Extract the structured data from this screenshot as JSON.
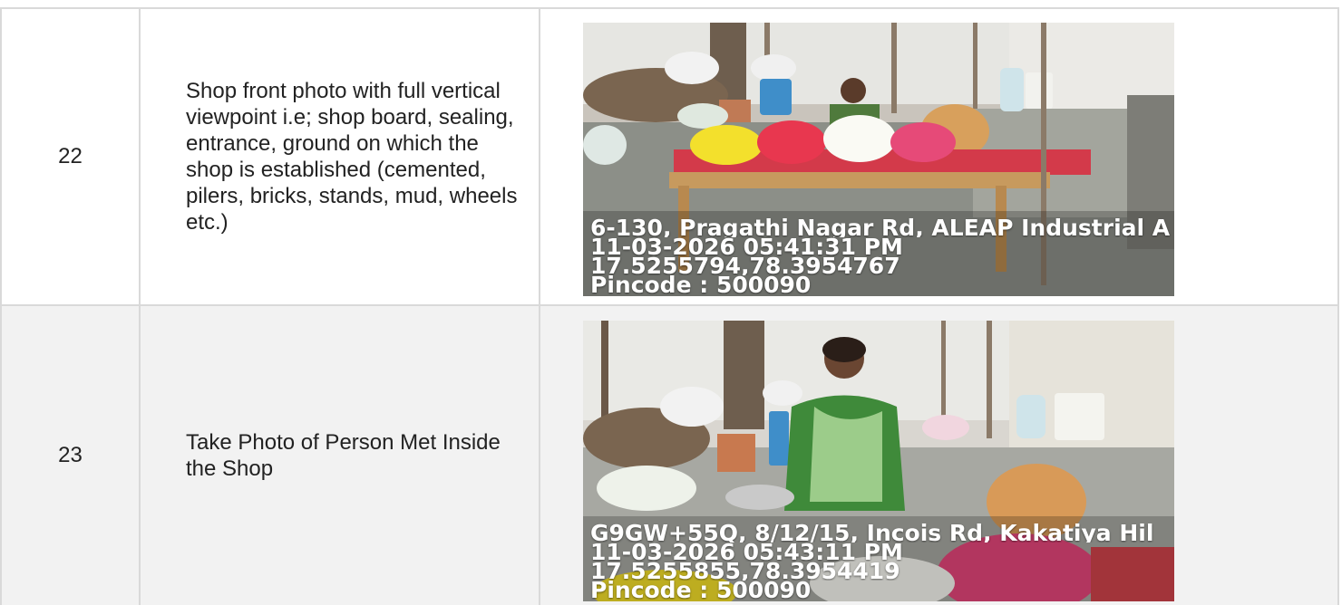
{
  "rows": [
    {
      "number": "22",
      "description": "Shop front photo with full vertical viewpoint i.e; shop board, sealing, entrance, ground on which the shop is established (cemented, pilers, bricks, stands, mud, wheels etc.)",
      "photo": {
        "address": "6-130, Pragathi Nagar Rd, ALEAP Industrial A",
        "datetime": "11-03-2026 05:41:31 PM",
        "coordinates": "17.5255794,78.3954767",
        "pincode": "Pincode : 500090"
      }
    },
    {
      "number": "23",
      "description": "Take Photo of Person Met Inside the Shop",
      "photo": {
        "address": "G9GW+55Q, 8/12/15, Incois Rd, Kakatiya Hil",
        "datetime": "11-03-2026 05:43:11 PM",
        "coordinates": "17.5255855,78.3954419",
        "pincode": "Pincode : 500090"
      }
    }
  ],
  "colors": {
    "border": "#d9d9d9",
    "alt_row": "#f2f2f2",
    "text": "#222222",
    "overlay_text": "#ffffff"
  }
}
